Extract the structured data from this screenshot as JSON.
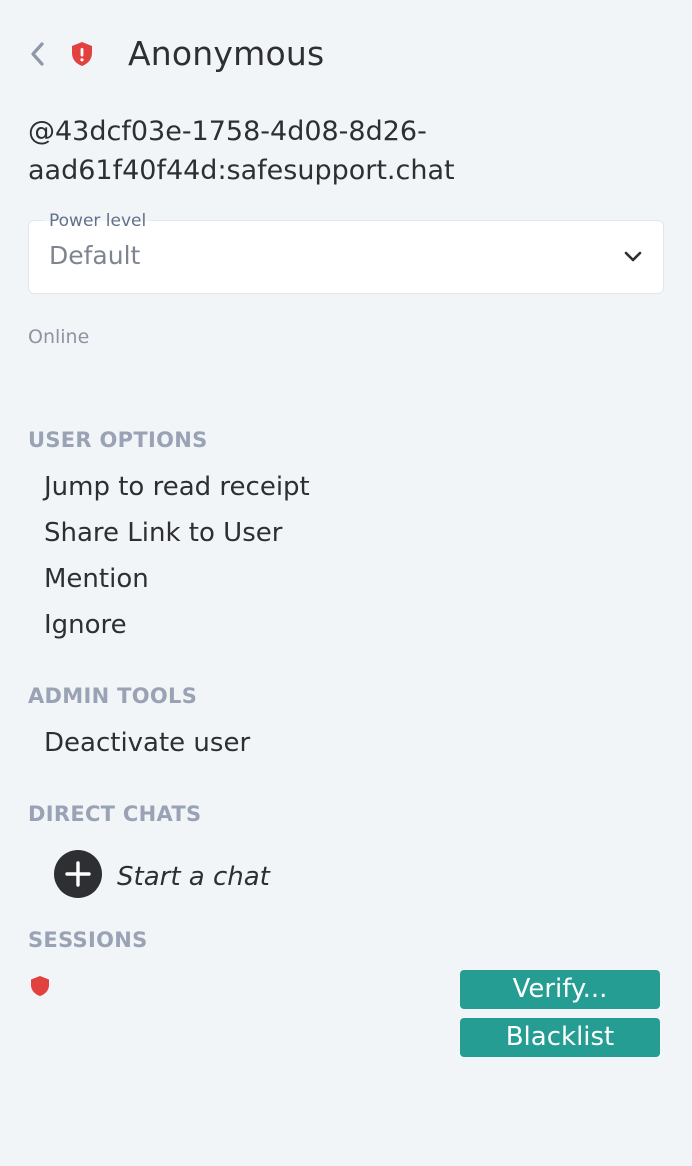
{
  "header": {
    "back_icon": "chevron-left-icon",
    "shield_icon": "shield-warning-icon",
    "title": "Anonymous"
  },
  "user": {
    "id_line1": "@43dcf03e-1758-4d08-8d26-",
    "id_line2": "aad61f40f44d:safesupport.chat",
    "presence": "Online"
  },
  "power_level": {
    "label": "Power level",
    "value": "Default",
    "icon": "chevron-down-icon"
  },
  "sections": {
    "user_options": {
      "title": "USER OPTIONS",
      "items": [
        "Jump to read receipt",
        "Share Link to User",
        "Mention",
        "Ignore"
      ]
    },
    "admin_tools": {
      "title": "ADMIN TOOLS",
      "items": [
        "Deactivate user"
      ]
    },
    "direct_chats": {
      "title": "DIRECT CHATS",
      "start_chat_label": "Start a chat",
      "icon": "plus-circle-icon"
    },
    "sessions": {
      "title": "SESSIONS",
      "shield_icon": "shield-warning-icon",
      "verify_label": "Verify...",
      "blacklist_label": "Blacklist"
    }
  },
  "colors": {
    "background": "#f2f5f8",
    "accent": "#259d93",
    "warning": "#e2423f",
    "section_title": "#9aa2b5",
    "text": "#2e2f32"
  }
}
